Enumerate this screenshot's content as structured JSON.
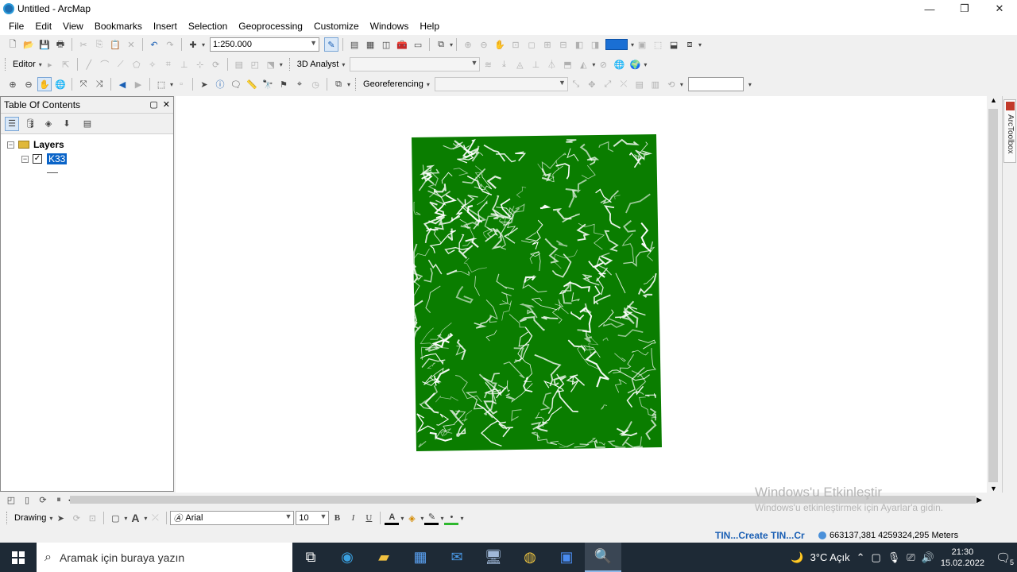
{
  "window": {
    "title": "Untitled - ArcMap",
    "minimize": "—",
    "maximize": "❐",
    "close": "✕"
  },
  "menu": [
    "File",
    "Edit",
    "View",
    "Bookmarks",
    "Insert",
    "Selection",
    "Geoprocessing",
    "Customize",
    "Windows",
    "Help"
  ],
  "toolbar": {
    "scale": "1:250.000",
    "editor_label": "Editor",
    "analyst_label": "3D Analyst",
    "analyst_layer": "",
    "georef_label": "Georeferencing",
    "georef_layer": ""
  },
  "toc": {
    "title": "Table Of Contents",
    "root": "Layers",
    "layer_name": "K33",
    "layer_checked": true
  },
  "map": {
    "contour_color": "#0a7d00"
  },
  "drawing": {
    "drawing_label": "Drawing",
    "font": "Arial",
    "font_size": "10",
    "bold": "B",
    "italic": "I",
    "underline": "U"
  },
  "status": {
    "tin": "TIN...Create TIN...Cr",
    "coords": "663137,381  4259324,295 Meters"
  },
  "watermark": {
    "title": "Windows'u Etkinleştir",
    "subtitle": "Windows'u etkinleştirmek için Ayarlar'a gidin."
  },
  "taskbar": {
    "search_placeholder": "Aramak için buraya yazın",
    "weather": "3°C  Açık",
    "time": "21:30",
    "date": "15.02.2022",
    "notifications": "5"
  },
  "toolbox_label": "ArcToolbox"
}
